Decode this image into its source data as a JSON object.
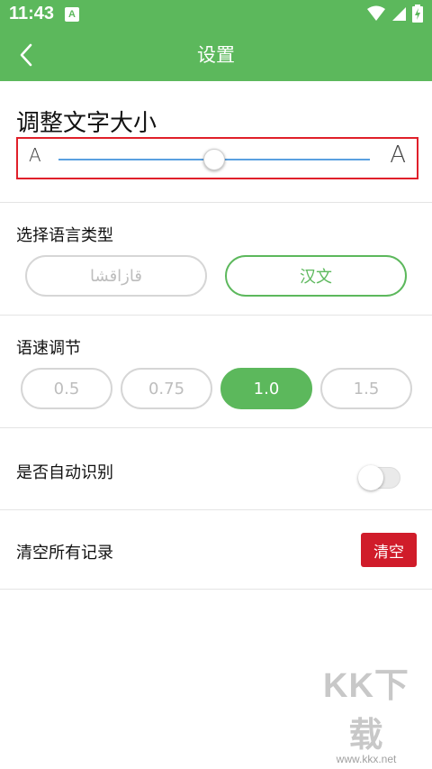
{
  "status_bar": {
    "time": "11:43",
    "notification_icon": "A",
    "icons": [
      "wifi-icon",
      "signal-icon",
      "battery-charging-icon"
    ]
  },
  "app_bar": {
    "title": "设置",
    "back_icon": "chevron-left-icon"
  },
  "font_size": {
    "title": "调整文字大小",
    "small_label": "A",
    "large_label": "A",
    "level_fraction": 0.5
  },
  "language": {
    "label": "选择语言类型",
    "options": [
      "قازاقشا",
      "汉文"
    ],
    "selected": "汉文"
  },
  "speech_speed": {
    "label": "语速调节",
    "options": [
      "0.5",
      "0.75",
      "1.0",
      "1.5"
    ],
    "selected": "1.0"
  },
  "auto_detect": {
    "label": "是否自动识别",
    "enabled": false
  },
  "clear_records": {
    "label": "清空所有记录",
    "button": "清空"
  },
  "watermark": {
    "main": "KK下载",
    "url": "www.kkx.net"
  },
  "colors": {
    "primary": "#5cb85c",
    "danger": "#d01c2a",
    "highlight_border": "#e0202a",
    "slider_track": "#5aa0e0"
  }
}
